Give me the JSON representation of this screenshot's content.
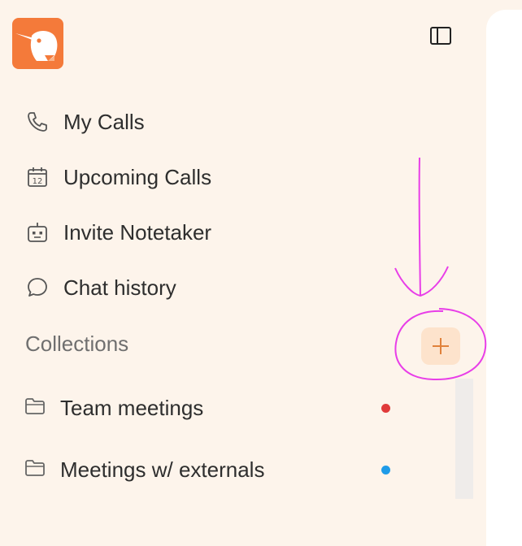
{
  "sidebar": {
    "logo_icon": "kiwi-bird-logo",
    "toggle_icon": "sidebar-toggle-icon",
    "nav": [
      {
        "label": "My Calls",
        "icon": "phone-icon"
      },
      {
        "label": "Upcoming Calls",
        "icon": "calendar-icon",
        "icon_text": "12"
      },
      {
        "label": "Invite Notetaker",
        "icon": "robot-icon"
      },
      {
        "label": "Chat history",
        "icon": "chat-bubble-icon"
      }
    ],
    "collections": {
      "title": "Collections",
      "add_icon": "plus-icon",
      "items": [
        {
          "label": "Team meetings",
          "icon": "folder-icon",
          "dot_color": "#e03a3a"
        },
        {
          "label": "Meetings w/ externals",
          "icon": "folder-icon",
          "dot_color": "#1e9be8"
        }
      ]
    }
  },
  "colors": {
    "brand": "#f47a3a",
    "sidebar_bg": "#fdf4eb",
    "annotation": "#e83ee8"
  }
}
